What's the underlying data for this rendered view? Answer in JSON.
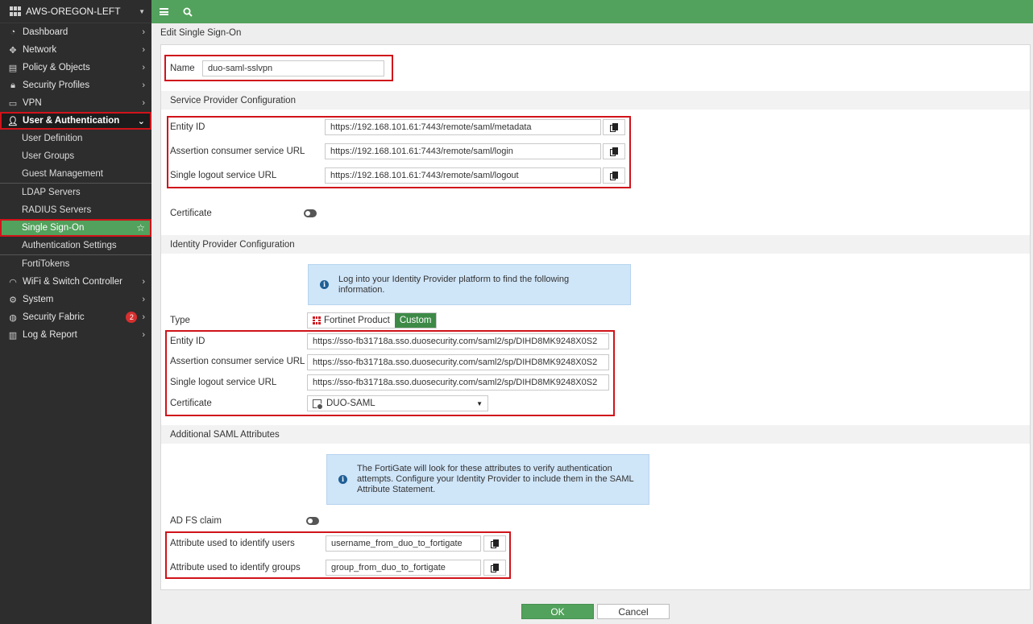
{
  "sidebar": {
    "device_name": "AWS-OREGON-LEFT",
    "items": [
      {
        "label": "Dashboard",
        "icon": "dashboard-icon"
      },
      {
        "label": "Network",
        "icon": "network-icon"
      },
      {
        "label": "Policy & Objects",
        "icon": "policy-icon"
      },
      {
        "label": "Security Profiles",
        "icon": "lock-icon"
      },
      {
        "label": "VPN",
        "icon": "monitor-icon"
      },
      {
        "label": "User & Authentication",
        "icon": "user-icon"
      },
      {
        "label": "WiFi & Switch Controller",
        "icon": "wifi-icon"
      },
      {
        "label": "System",
        "icon": "gear-icon"
      },
      {
        "label": "Security Fabric",
        "icon": "fabric-icon",
        "badge": "2"
      },
      {
        "label": "Log & Report",
        "icon": "chart-icon"
      }
    ],
    "user_auth_sub": [
      "User Definition",
      "User Groups",
      "Guest Management",
      "LDAP Servers",
      "RADIUS Servers",
      "Single Sign-On",
      "Authentication Settings",
      "FortiTokens"
    ]
  },
  "breadcrumb": "Edit Single Sign-On",
  "form": {
    "name_label": "Name",
    "name_value": "duo-saml-sslvpn",
    "sp_section": "Service Provider Configuration",
    "sp_entity_label": "Entity ID",
    "sp_entity_value": "https://192.168.101.61:7443/remote/saml/metadata",
    "sp_acs_label": "Assertion consumer service URL",
    "sp_acs_value": "https://192.168.101.61:7443/remote/saml/login",
    "sp_slo_label": "Single logout service URL",
    "sp_slo_value": "https://192.168.101.61:7443/remote/saml/logout",
    "certificate_label": "Certificate",
    "idp_section": "Identity Provider Configuration",
    "idp_info": "Log into your Identity Provider platform to find the following information.",
    "type_label": "Type",
    "type_options": [
      "Fortinet Product",
      "Custom"
    ],
    "type_selected": "Custom",
    "idp_entity_label": "Entity ID",
    "idp_entity_value": "https://sso-fb31718a.sso.duosecurity.com/saml2/sp/DIHD8MK9248X0S2",
    "idp_acs_label": "Assertion consumer service URL",
    "idp_acs_value": "https://sso-fb31718a.sso.duosecurity.com/saml2/sp/DIHD8MK9248X0S2",
    "idp_slo_label": "Single logout service URL",
    "idp_slo_value": "https://sso-fb31718a.sso.duosecurity.com/saml2/sp/DIHD8MK9248X0S2",
    "idp_cert_label": "Certificate",
    "idp_cert_value": "DUO-SAML",
    "attr_section": "Additional SAML Attributes",
    "attr_info": "The FortiGate will look for these attributes to verify authentication attempts. Configure your Identity Provider to include them in the SAML Attribute Statement.",
    "adfs_label": "AD FS claim",
    "attr_users_label": "Attribute used to identify users",
    "attr_users_value": "username_from_duo_to_fortigate",
    "attr_groups_label": "Attribute used to identify groups",
    "attr_groups_value": "group_from_duo_to_fortigate"
  },
  "buttons": {
    "ok": "OK",
    "cancel": "Cancel"
  },
  "colors": {
    "accent": "#52a15c",
    "sidebar_bg": "#2d2d2d",
    "highlight_red": "#d0131a",
    "info_bg": "#cfe5f8"
  }
}
